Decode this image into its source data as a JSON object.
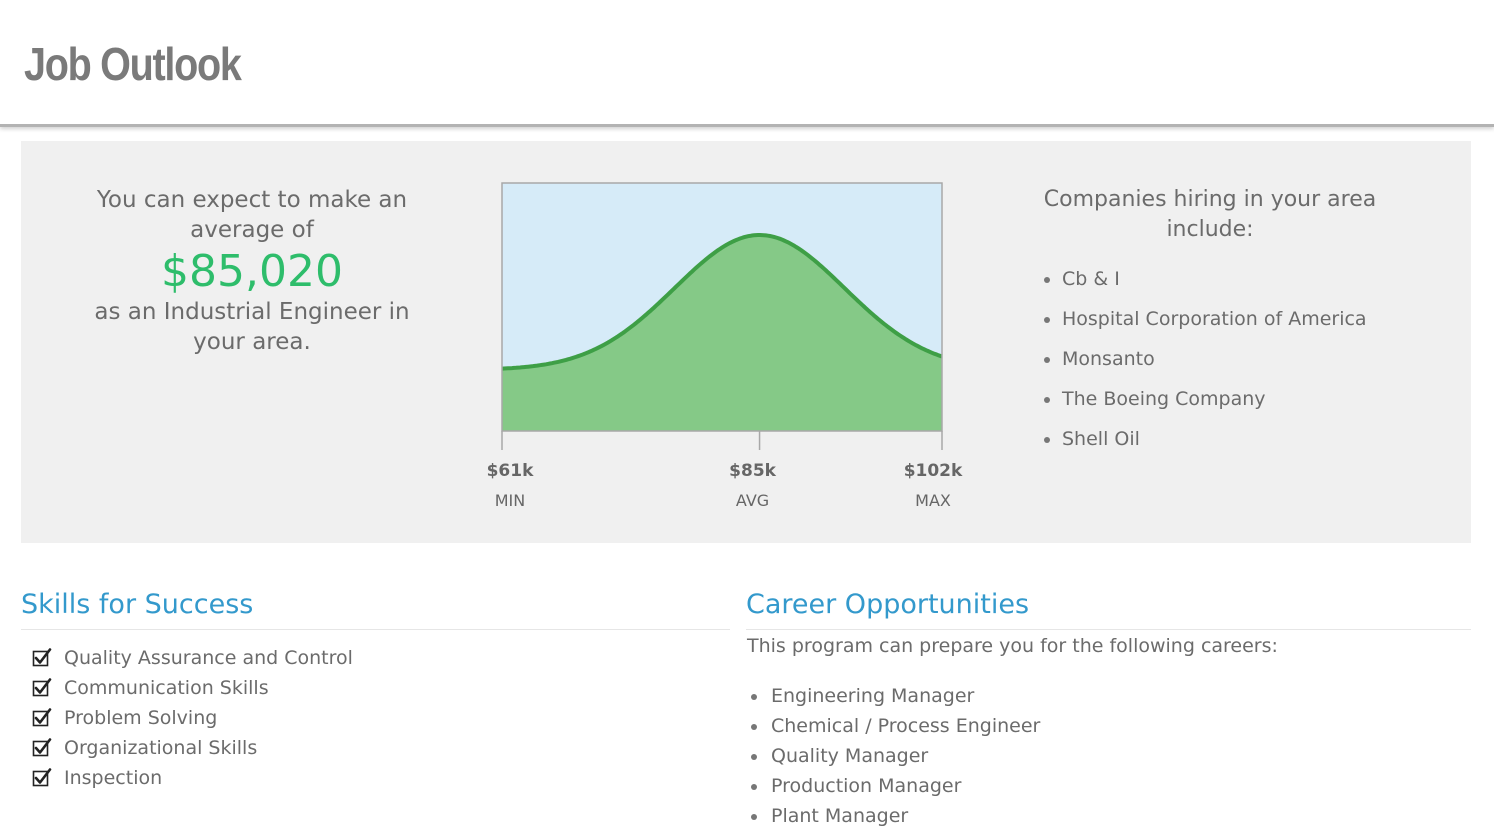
{
  "header": {
    "title": "Job Outlook"
  },
  "salary": {
    "intro": "You can expect to make an average of",
    "intro_line1": "You can expect to make an",
    "intro_line2": "average of",
    "average": "$85,020",
    "outro": "as an Industrial Engineer in your area.",
    "outro_line1": "as an Industrial Engineer in",
    "outro_line2": "your area."
  },
  "chart_data": {
    "type": "area",
    "x_ticks": [
      {
        "value": 61,
        "label": "$61k",
        "caption": "MIN"
      },
      {
        "value": 85,
        "label": "$85k",
        "caption": "AVG"
      },
      {
        "value": 102,
        "label": "$102k",
        "caption": "MAX"
      }
    ],
    "xlim": [
      61,
      102
    ],
    "distribution_peak": 85,
    "fill_color": "#85c987",
    "line_color": "#3e9f46",
    "background_color": "#d6ebf8",
    "grid": false,
    "legend": false
  },
  "companies": {
    "heading": "Companies hiring in your area include:",
    "heading_line1": "Companies hiring in your area",
    "heading_line2": "include:",
    "items": [
      "Cb & I",
      "Hospital Corporation of America",
      "Monsanto",
      "The Boeing Company",
      "Shell Oil"
    ]
  },
  "skills": {
    "title": "Skills for Success",
    "items": [
      "Quality Assurance and Control",
      "Communication Skills",
      "Problem Solving",
      "Organizational Skills",
      "Inspection"
    ],
    "icon": "checkbox-checked-icon"
  },
  "careers": {
    "title": "Career Opportunities",
    "intro": "This program can prepare you for the following careers:",
    "items": [
      "Engineering Manager",
      "Chemical / Process Engineer",
      "Quality Manager",
      "Production Manager",
      "Plant Manager"
    ]
  },
  "colors": {
    "accent_blue": "#3399cc",
    "salary_green": "#2ebd6b",
    "panel_gray": "#f0f0f0",
    "text_gray": "#6b6b6b"
  }
}
